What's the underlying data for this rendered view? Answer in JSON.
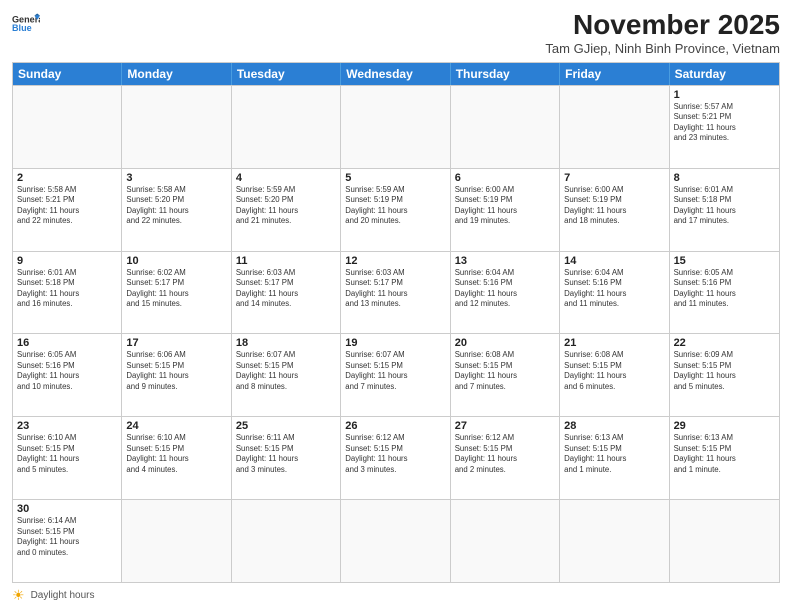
{
  "header": {
    "logo_line1": "General",
    "logo_line2": "Blue",
    "month": "November 2025",
    "location": "Tam GJiep, Ninh Binh Province, Vietnam"
  },
  "day_headers": [
    "Sunday",
    "Monday",
    "Tuesday",
    "Wednesday",
    "Thursday",
    "Friday",
    "Saturday"
  ],
  "weeks": [
    [
      {
        "day": "",
        "info": ""
      },
      {
        "day": "",
        "info": ""
      },
      {
        "day": "",
        "info": ""
      },
      {
        "day": "",
        "info": ""
      },
      {
        "day": "",
        "info": ""
      },
      {
        "day": "",
        "info": ""
      },
      {
        "day": "1",
        "info": "Sunrise: 5:57 AM\nSunset: 5:21 PM\nDaylight: 11 hours\nand 23 minutes."
      }
    ],
    [
      {
        "day": "2",
        "info": "Sunrise: 5:58 AM\nSunset: 5:21 PM\nDaylight: 11 hours\nand 22 minutes."
      },
      {
        "day": "3",
        "info": "Sunrise: 5:58 AM\nSunset: 5:20 PM\nDaylight: 11 hours\nand 22 minutes."
      },
      {
        "day": "4",
        "info": "Sunrise: 5:59 AM\nSunset: 5:20 PM\nDaylight: 11 hours\nand 21 minutes."
      },
      {
        "day": "5",
        "info": "Sunrise: 5:59 AM\nSunset: 5:19 PM\nDaylight: 11 hours\nand 20 minutes."
      },
      {
        "day": "6",
        "info": "Sunrise: 6:00 AM\nSunset: 5:19 PM\nDaylight: 11 hours\nand 19 minutes."
      },
      {
        "day": "7",
        "info": "Sunrise: 6:00 AM\nSunset: 5:19 PM\nDaylight: 11 hours\nand 18 minutes."
      },
      {
        "day": "8",
        "info": "Sunrise: 6:01 AM\nSunset: 5:18 PM\nDaylight: 11 hours\nand 17 minutes."
      }
    ],
    [
      {
        "day": "9",
        "info": "Sunrise: 6:01 AM\nSunset: 5:18 PM\nDaylight: 11 hours\nand 16 minutes."
      },
      {
        "day": "10",
        "info": "Sunrise: 6:02 AM\nSunset: 5:17 PM\nDaylight: 11 hours\nand 15 minutes."
      },
      {
        "day": "11",
        "info": "Sunrise: 6:03 AM\nSunset: 5:17 PM\nDaylight: 11 hours\nand 14 minutes."
      },
      {
        "day": "12",
        "info": "Sunrise: 6:03 AM\nSunset: 5:17 PM\nDaylight: 11 hours\nand 13 minutes."
      },
      {
        "day": "13",
        "info": "Sunrise: 6:04 AM\nSunset: 5:16 PM\nDaylight: 11 hours\nand 12 minutes."
      },
      {
        "day": "14",
        "info": "Sunrise: 6:04 AM\nSunset: 5:16 PM\nDaylight: 11 hours\nand 11 minutes."
      },
      {
        "day": "15",
        "info": "Sunrise: 6:05 AM\nSunset: 5:16 PM\nDaylight: 11 hours\nand 11 minutes."
      }
    ],
    [
      {
        "day": "16",
        "info": "Sunrise: 6:05 AM\nSunset: 5:16 PM\nDaylight: 11 hours\nand 10 minutes."
      },
      {
        "day": "17",
        "info": "Sunrise: 6:06 AM\nSunset: 5:15 PM\nDaylight: 11 hours\nand 9 minutes."
      },
      {
        "day": "18",
        "info": "Sunrise: 6:07 AM\nSunset: 5:15 PM\nDaylight: 11 hours\nand 8 minutes."
      },
      {
        "day": "19",
        "info": "Sunrise: 6:07 AM\nSunset: 5:15 PM\nDaylight: 11 hours\nand 7 minutes."
      },
      {
        "day": "20",
        "info": "Sunrise: 6:08 AM\nSunset: 5:15 PM\nDaylight: 11 hours\nand 7 minutes."
      },
      {
        "day": "21",
        "info": "Sunrise: 6:08 AM\nSunset: 5:15 PM\nDaylight: 11 hours\nand 6 minutes."
      },
      {
        "day": "22",
        "info": "Sunrise: 6:09 AM\nSunset: 5:15 PM\nDaylight: 11 hours\nand 5 minutes."
      }
    ],
    [
      {
        "day": "23",
        "info": "Sunrise: 6:10 AM\nSunset: 5:15 PM\nDaylight: 11 hours\nand 5 minutes."
      },
      {
        "day": "24",
        "info": "Sunrise: 6:10 AM\nSunset: 5:15 PM\nDaylight: 11 hours\nand 4 minutes."
      },
      {
        "day": "25",
        "info": "Sunrise: 6:11 AM\nSunset: 5:15 PM\nDaylight: 11 hours\nand 3 minutes."
      },
      {
        "day": "26",
        "info": "Sunrise: 6:12 AM\nSunset: 5:15 PM\nDaylight: 11 hours\nand 3 minutes."
      },
      {
        "day": "27",
        "info": "Sunrise: 6:12 AM\nSunset: 5:15 PM\nDaylight: 11 hours\nand 2 minutes."
      },
      {
        "day": "28",
        "info": "Sunrise: 6:13 AM\nSunset: 5:15 PM\nDaylight: 11 hours\nand 1 minute."
      },
      {
        "day": "29",
        "info": "Sunrise: 6:13 AM\nSunset: 5:15 PM\nDaylight: 11 hours\nand 1 minute."
      }
    ],
    [
      {
        "day": "30",
        "info": "Sunrise: 6:14 AM\nSunset: 5:15 PM\nDaylight: 11 hours\nand 0 minutes."
      },
      {
        "day": "",
        "info": ""
      },
      {
        "day": "",
        "info": ""
      },
      {
        "day": "",
        "info": ""
      },
      {
        "day": "",
        "info": ""
      },
      {
        "day": "",
        "info": ""
      },
      {
        "day": "",
        "info": ""
      }
    ]
  ],
  "footer": {
    "icon": "☀",
    "text": "Daylight hours"
  }
}
